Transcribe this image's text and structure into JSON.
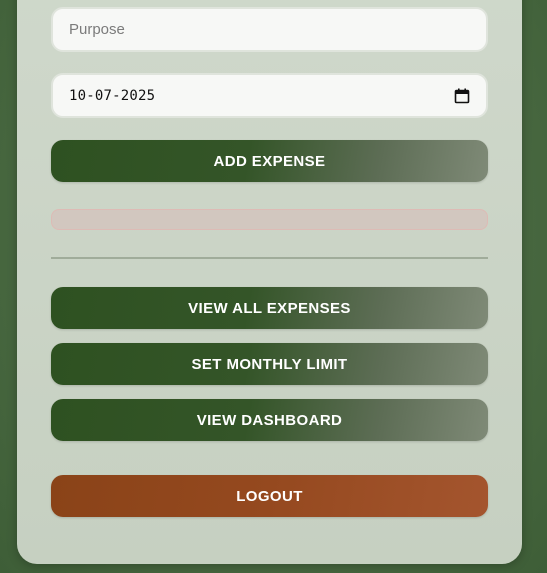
{
  "form": {
    "purpose_placeholder": "Purpose",
    "date_value": "10-07-2025",
    "add_expense_label": "ADD EXPENSE"
  },
  "message": {
    "text": ""
  },
  "actions": {
    "view_all_label": "VIEW ALL EXPENSES",
    "set_limit_label": "SET MONTHLY LIMIT",
    "dashboard_label": "VIEW DASHBOARD",
    "logout_label": "LOGOUT"
  },
  "icons": {
    "date_picker": "calendar-icon"
  },
  "colors": {
    "primary_button": "#2e5121",
    "logout_button": "#8a4318",
    "card_background": "#cfd8cb",
    "page_background": "#4a6a42",
    "error_border": "#e0b9b4"
  }
}
